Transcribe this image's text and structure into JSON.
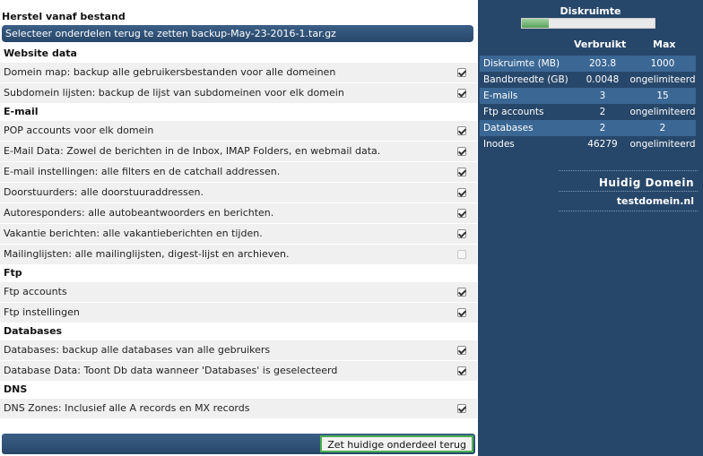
{
  "left": {
    "title": "Herstel vanaf bestand",
    "subheader": "Selecteer onderdelen terug te zetten backup-May-23-2016-1.tar.gz",
    "sections": [
      {
        "name": "Website data",
        "items": [
          {
            "label": "Domein map: backup alle gebruikersbestanden voor alle domeinen",
            "checked": true
          },
          {
            "label": "Subdomein lijsten: backup de lijst van subdomeinen voor elk domein",
            "checked": true
          }
        ]
      },
      {
        "name": "E-mail",
        "items": [
          {
            "label": "POP accounts voor elk domein",
            "checked": true
          },
          {
            "label": "E-Mail Data: Zowel de berichten in de Inbox, IMAP Folders, en webmail data.",
            "checked": true
          },
          {
            "label": "E-mail instellingen: alle filters en de catchall addressen.",
            "checked": true
          },
          {
            "label": "Doorstuurders: alle doorstuuraddressen.",
            "checked": true
          },
          {
            "label": "Autoresponders: alle autobeantwoorders en berichten.",
            "checked": true
          },
          {
            "label": "Vakantie berichten: alle vakantieberichten en tijden.",
            "checked": true
          },
          {
            "label": "Mailinglijsten: alle mailinglijsten, digest-lijst en archieven.",
            "checked": false
          }
        ]
      },
      {
        "name": "Ftp",
        "items": [
          {
            "label": "Ftp accounts",
            "checked": true
          },
          {
            "label": "Ftp instellingen",
            "checked": true
          }
        ]
      },
      {
        "name": "Databases",
        "items": [
          {
            "label": "Databases: backup alle databases van alle gebruikers",
            "checked": true
          },
          {
            "label": "Database Data: Toont Db data wanneer 'Databases' is geselecteerd",
            "checked": true
          }
        ]
      },
      {
        "name": "DNS",
        "items": [
          {
            "label": "DNS Zones: Inclusief alle A records en MX records",
            "checked": true
          }
        ]
      }
    ],
    "restore_button": "Zet huidige onderdeel terug"
  },
  "right": {
    "disk_title": "Diskruimte",
    "disk_usage_fraction": 0.2,
    "col_used": "Verbruikt",
    "col_max": "Max",
    "stats": [
      {
        "key": "Diskruimte (MB)",
        "used": "203.8",
        "max": "1000"
      },
      {
        "key": "Bandbreedte (GB)",
        "used": "0.0048",
        "max": "ongelimiteerd"
      },
      {
        "key": "E-mails",
        "used": "3",
        "max": "15"
      },
      {
        "key": "Ftp accounts",
        "used": "2",
        "max": "ongelimiteerd"
      },
      {
        "key": "Databases",
        "used": "2",
        "max": "2"
      },
      {
        "key": "Inodes",
        "used": "46279",
        "max": "ongelimiteerd"
      }
    ],
    "domain_title": "Huidig Domein",
    "domain_name": "testdomein.nl"
  },
  "colors": {
    "panel": "#27476a",
    "row": "#f0f0f0",
    "accent_green": "#4caf50"
  }
}
